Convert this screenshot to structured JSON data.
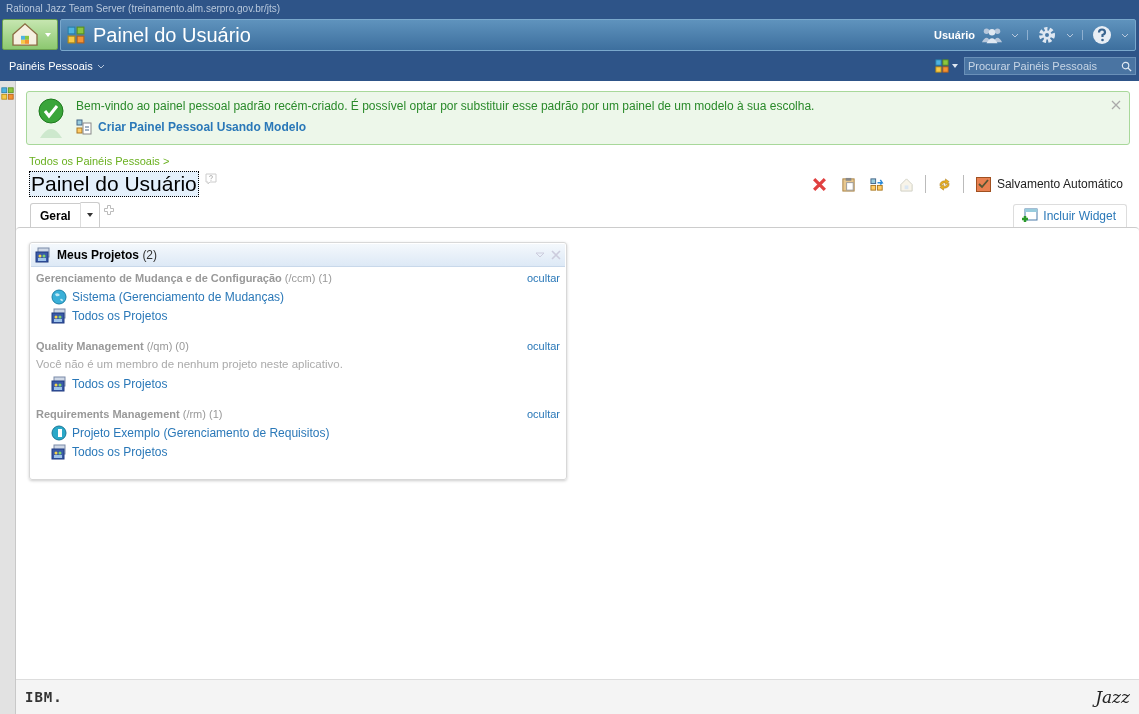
{
  "window": {
    "title": "Rational Jazz Team Server (treinamento.alm.serpro.gov.br/jts)"
  },
  "banner": {
    "title": "Painel do Usuário",
    "user": "Usuário"
  },
  "subbar": {
    "menu": "Painéis Pessoais",
    "search": {
      "placeholder": "Procurar Painéis Pessoais"
    }
  },
  "notice": {
    "message": "Bem-vindo ao painel pessoal padrão recém-criado. É possível optar por substituir esse padrão por um painel de um modelo à sua escolha.",
    "link": "Criar Painel Pessoal Usando Modelo"
  },
  "breadcrumb": "Todos os Painéis Pessoais >",
  "dashboard": {
    "title": "Painel do Usuário",
    "autosave": {
      "label": "Salvamento Automático",
      "checked": true
    },
    "add_widget": "Incluir Widget"
  },
  "tabs": [
    {
      "label": "Geral",
      "selected": true
    }
  ],
  "widget": {
    "title": "Meus Projetos",
    "count": "(2)",
    "sections": [
      {
        "name": "Gerenciamento de Mudança e de Configuração",
        "path": "(/ccm)",
        "count": "(1)",
        "hide": "ocultar",
        "items": [
          {
            "kind": "globe",
            "label": "Sistema (Gerenciamento de Mudanças)"
          },
          {
            "kind": "all",
            "label": "Todos os Projetos"
          }
        ]
      },
      {
        "name": "Quality Management",
        "path": "(/qm)",
        "count": "(0)",
        "hide": "ocultar",
        "message": "Você não é um membro de nenhum projeto neste aplicativo.",
        "items": [
          {
            "kind": "all",
            "label": "Todos os Projetos"
          }
        ]
      },
      {
        "name": "Requirements Management",
        "path": "(/rm)",
        "count": "(1)",
        "hide": "ocultar",
        "items": [
          {
            "kind": "rm",
            "label": "Projeto Exemplo (Gerenciamento de Requisitos)"
          },
          {
            "kind": "all",
            "label": "Todos os Projetos"
          }
        ]
      }
    ]
  },
  "footer": {
    "left_logo": "IBM.",
    "right_logo": "Jazz"
  }
}
